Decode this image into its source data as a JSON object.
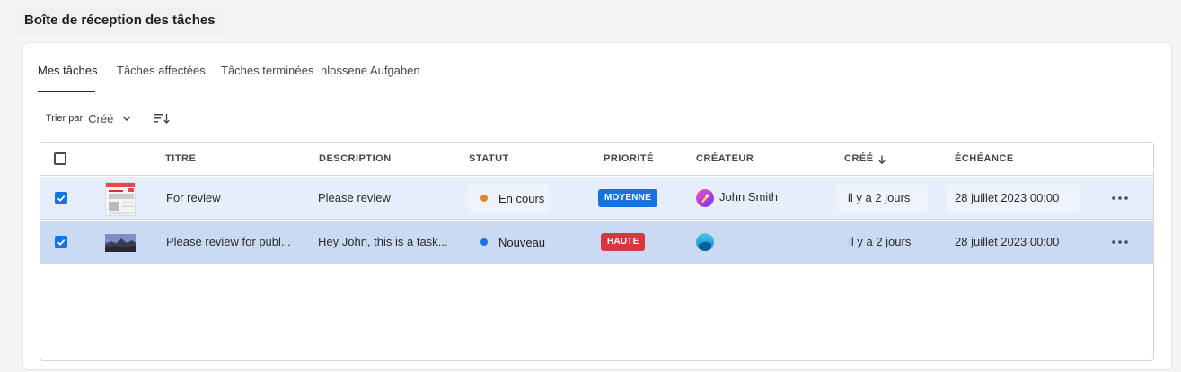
{
  "page": {
    "title": "Boîte de réception des tâches"
  },
  "tabs": [
    {
      "label": "Mes tâches",
      "active": true
    },
    {
      "label": "Tâches affectées",
      "active": false
    },
    {
      "label": "Tâches terminées",
      "active": false
    },
    {
      "label": "hlossene Aufgaben",
      "active": false
    }
  ],
  "sort": {
    "label": "Trier par",
    "value": "Créé"
  },
  "table": {
    "headers": [
      "TITRE",
      "DESCRIPTION",
      "STATUT",
      "PRIORITÉ",
      "CRÉATEUR",
      "CRÉÉ",
      "ÉCHÉANCE"
    ],
    "rows": [
      {
        "selected": true,
        "title": "For review",
        "description": "Please review",
        "status": "En cours",
        "status_color": "#e68619",
        "priority": "MOYENNE",
        "priority_color": "#1473e6",
        "creator": "John Smith",
        "created": "il y a 2 jours",
        "due": "28 juillet 2023 00:00"
      },
      {
        "selected": true,
        "title": "Please review for publ...",
        "description": "Hey John, this is a task...",
        "status": "Nouveau",
        "status_color": "#1473e6",
        "priority": "HAUTE",
        "priority_color": "#d7373f",
        "creator": "",
        "created": "il y a 2 jours",
        "due": "28 juillet 2023 00:00"
      }
    ]
  },
  "colors": {
    "accent": "#1473e6",
    "row_selected": "#e6eefa",
    "row_selected_strong": "#c9daf2"
  }
}
